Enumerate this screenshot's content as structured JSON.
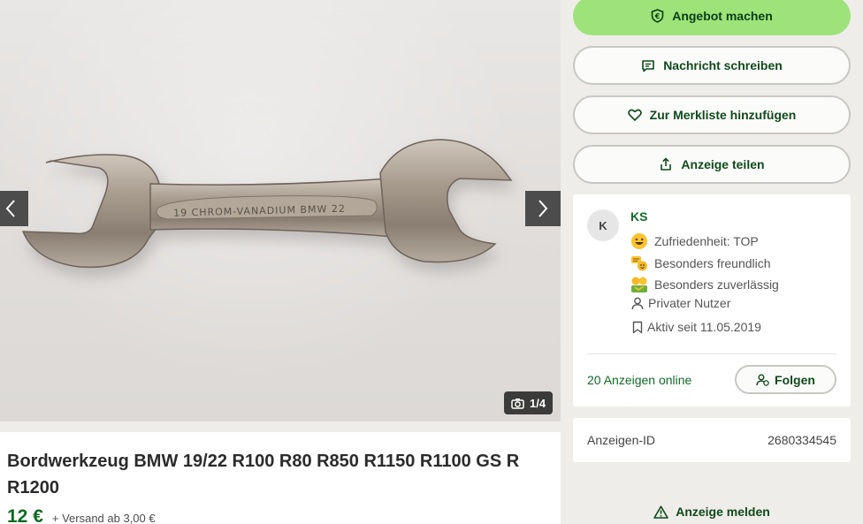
{
  "gallery": {
    "counter": "1/4"
  },
  "ad": {
    "title": "Bordwerkzeug BMW 19/22 R100 R80 R850 R1150 R1100 GS R R1200",
    "price": "12 €",
    "shipping": "+ Versand ab 3,00 €"
  },
  "wrench": {
    "engraving": "19  CHROM-VANADIUM  BMW  22"
  },
  "actions": {
    "offer": "Angebot machen",
    "message": "Nachricht schreiben",
    "watchlist": "Zur Merkliste hinzufügen",
    "share": "Anzeige teilen"
  },
  "seller": {
    "initial": "K",
    "name": "KS",
    "badges": [
      {
        "icon": "smiley-icon",
        "label": "Zufriedenheit: TOP"
      },
      {
        "icon": "friendly-chat-icon",
        "label": "Besonders freundlich"
      },
      {
        "icon": "reliable-icon",
        "label": "Besonders zuverlässig"
      }
    ],
    "type": "Privater Nutzer",
    "active_since": "Aktiv seit 11.05.2019",
    "ads_online": "20 Anzeigen online",
    "follow": "Folgen"
  },
  "ad_id": {
    "label": "Anzeigen-ID",
    "value": "2680334545"
  },
  "report": {
    "label": "Anzeige melden"
  },
  "colors": {
    "primary_button": "#9de37a",
    "brand_green": "#0b6b21",
    "page_background": "#efede9"
  }
}
